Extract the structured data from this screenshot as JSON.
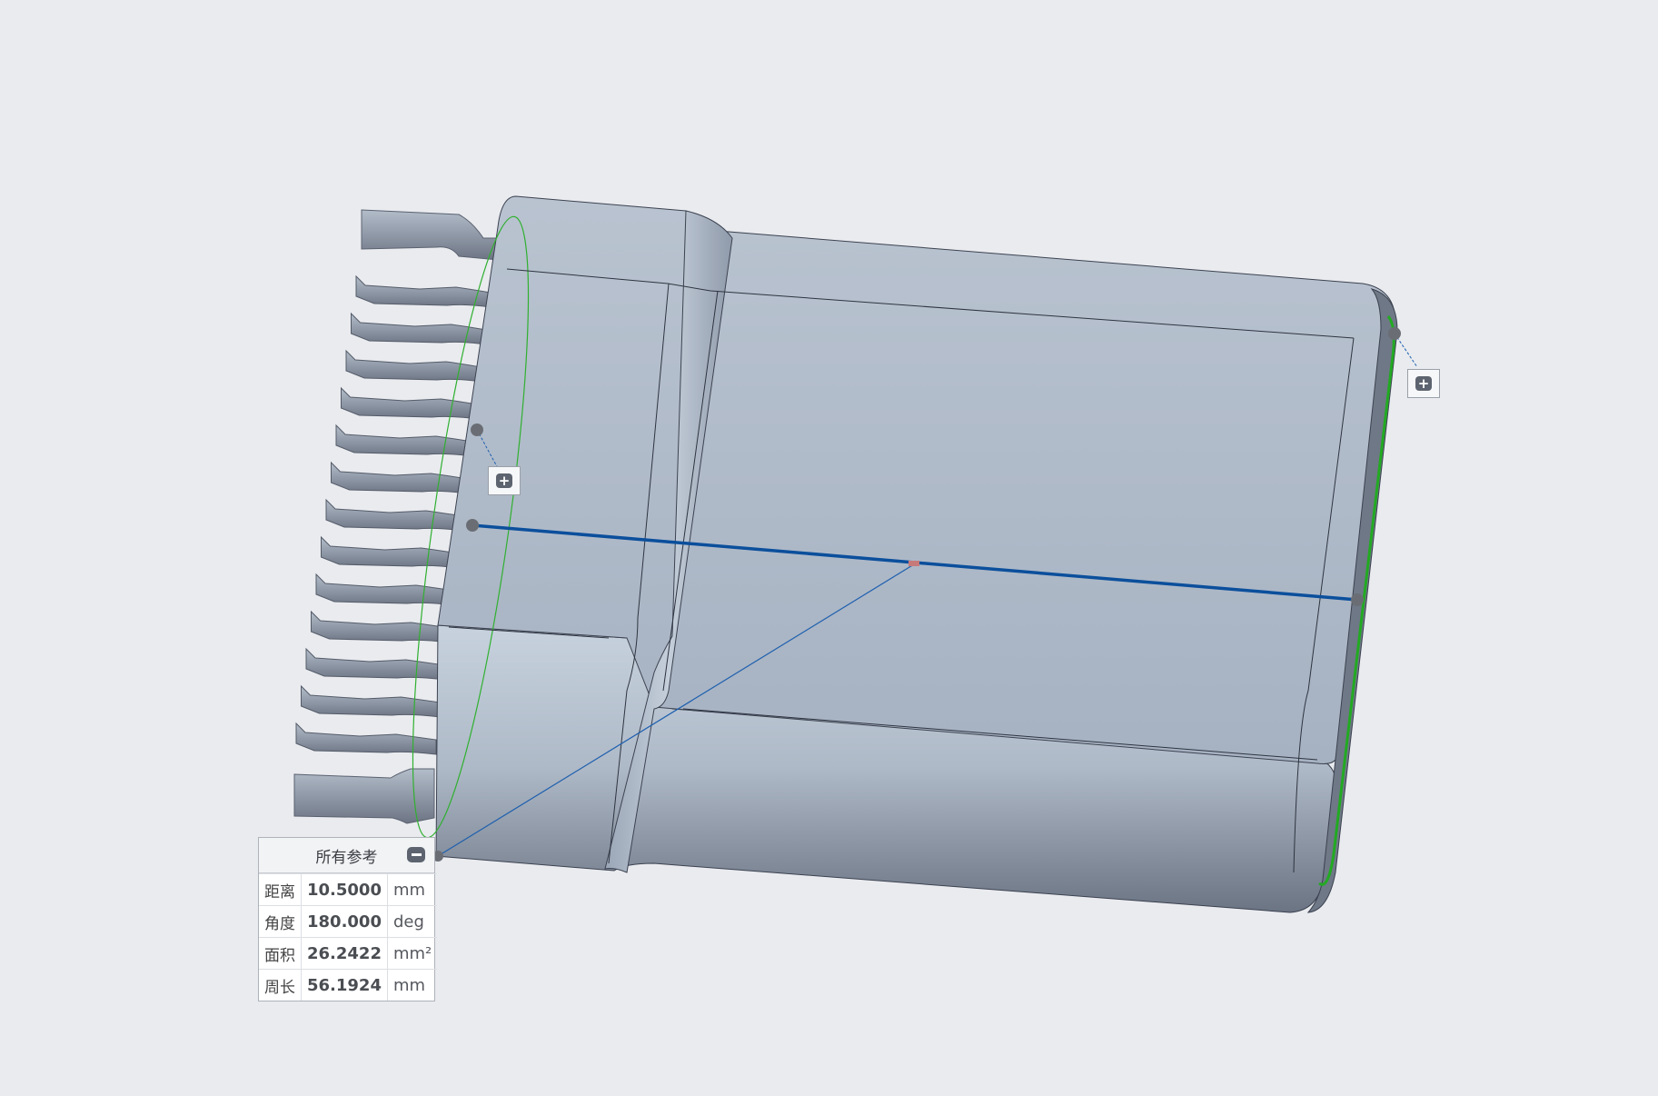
{
  "measurement_panel": {
    "title": "所有参考",
    "rows": [
      {
        "label": "距离",
        "value": "10.5000",
        "unit": "mm"
      },
      {
        "label": "角度",
        "value": "180.000",
        "unit": "deg"
      },
      {
        "label": "面积",
        "value": "26.2422",
        "unit": "mm²"
      },
      {
        "label": "周长",
        "value": "56.1924",
        "unit": "mm"
      }
    ]
  },
  "viewport": {
    "background_color": "#e9ebef",
    "model_color": "#a4b0c0",
    "measure_line_color": "#0b4f9c",
    "highlight_edge_color": "#22aa22"
  },
  "icons": {
    "expand_icon": "plus-icon",
    "collapse_icon": "minus-icon"
  }
}
